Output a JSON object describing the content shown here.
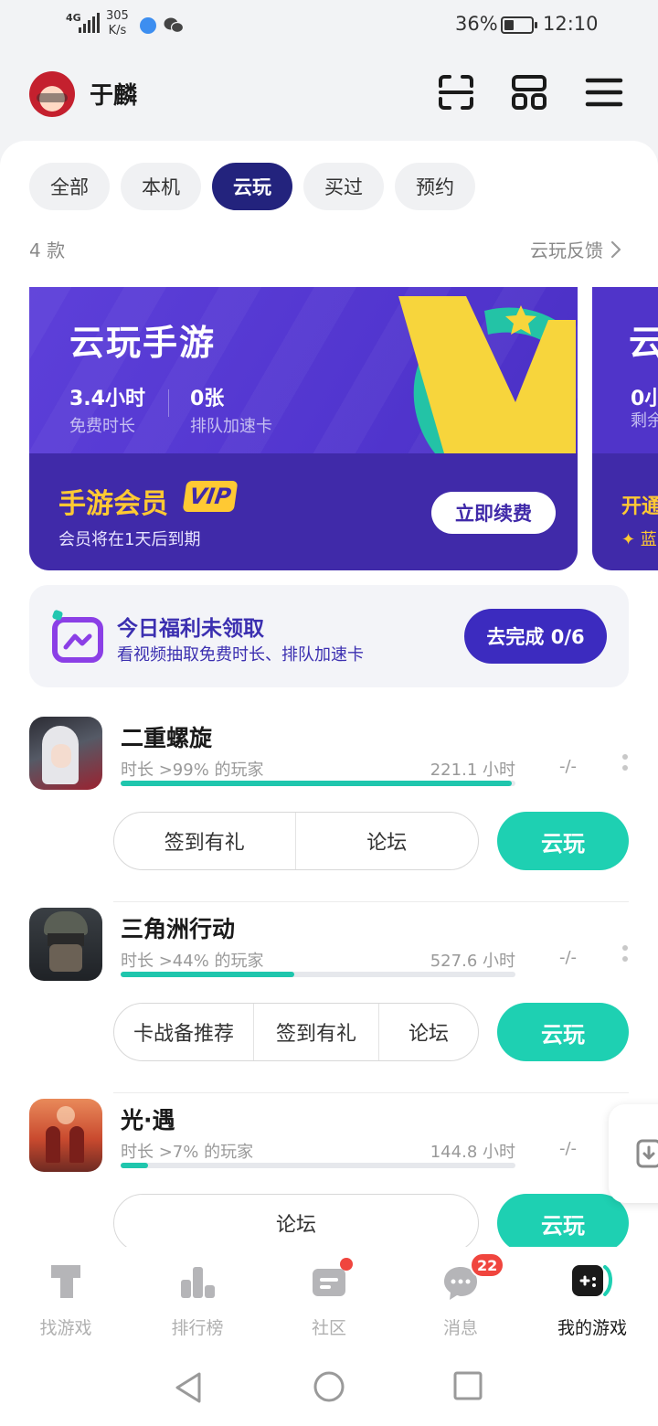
{
  "status_bar": {
    "signal": "4G",
    "speed_value": "305",
    "speed_unit": "K/s",
    "battery_pct": "36%",
    "battery_level": 0.36,
    "time": "12:10"
  },
  "header": {
    "username": "于麟"
  },
  "filters": {
    "chips": [
      "全部",
      "本机",
      "云玩",
      "买过",
      "预约"
    ],
    "active_index": 2
  },
  "list_meta": {
    "count": "4 款",
    "feedback": "云玩反馈"
  },
  "banner": {
    "title": "云玩手游",
    "free_time_value": "3.4小时",
    "free_time_label": "免费时长",
    "queue_cards_value": "0张",
    "queue_cards_label": "排队加速卡",
    "member_title": "手游会员",
    "vip_badge": "VIP",
    "member_sub": "会员将在1天后到期",
    "renew_button": "立即续费"
  },
  "banner2": {
    "title": "云",
    "stat": "0小",
    "stat_label": "剩余",
    "member": "开通",
    "sub": "✦ 蓝"
  },
  "welfare": {
    "title": "今日福利未领取",
    "subtitle": "看视频抽取免费时长、排队加速卡",
    "button": "去完成 0/6"
  },
  "games": [
    {
      "name": "二重螺旋",
      "rank": "时长 >99% 的玩家",
      "hours": "221.1 小时",
      "extra": "-/-",
      "progress": 0.99,
      "actions": [
        "签到有礼",
        "论坛"
      ],
      "play": "云玩"
    },
    {
      "name": "三角洲行动",
      "rank": "时长 >44% 的玩家",
      "hours": "527.6 小时",
      "extra": "-/-",
      "progress": 0.44,
      "actions": [
        "卡战备推荐",
        "签到有礼",
        "论坛"
      ],
      "play": "云玩"
    },
    {
      "name": "光·遇",
      "rank": "时长 >7% 的玩家",
      "hours": "144.8 小时",
      "extra": "-/-",
      "progress": 0.07,
      "actions": [
        "论坛"
      ],
      "play": "云玩"
    }
  ],
  "tabbar": {
    "items": [
      "找游戏",
      "排行榜",
      "社区",
      "消息",
      "我的游戏"
    ],
    "active_index": 4,
    "messages_badge": "22"
  },
  "colors": {
    "accent_teal": "#1ed0b2",
    "brand_purple": "#3c2bbf",
    "chip_active": "#23237d",
    "vip_gold": "#ffc933",
    "badge_red": "#f0453e"
  }
}
